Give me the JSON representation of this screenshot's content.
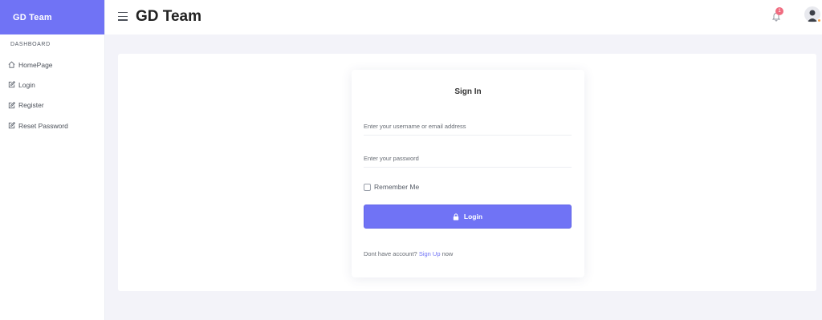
{
  "brand": {
    "name": "GD Team"
  },
  "sidebar": {
    "section_title": "DASHBOARD",
    "items": [
      {
        "label": "HomePage",
        "icon": "home-icon"
      },
      {
        "label": "Login",
        "icon": "edit-icon"
      },
      {
        "label": "Register",
        "icon": "edit-icon"
      },
      {
        "label": "Reset Password",
        "icon": "edit-icon"
      }
    ]
  },
  "header": {
    "title": "GD Team",
    "notification_count": "1"
  },
  "signin": {
    "title": "Sign In",
    "username_placeholder": "Enter your username or email address",
    "password_placeholder": "Enter your password",
    "remember_label": "Remember Me",
    "login_label": "Login",
    "signup_prefix": "Dont have account?",
    "signup_link": "Sign Up",
    "signup_suffix": "now"
  },
  "colors": {
    "accent": "#7073f5",
    "background": "#f3f3f9",
    "badge": "#f06c80"
  }
}
